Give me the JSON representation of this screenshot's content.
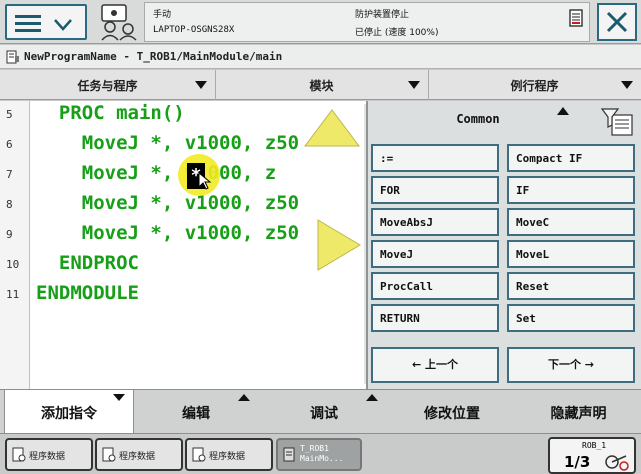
{
  "status": {
    "mode": "手动",
    "system": "LAPTOP-OSGNS28X",
    "safety": "防护装置停止",
    "state": "已停止 (速度 100%)"
  },
  "path": "NewProgramName - T_ROB1/MainModule/main",
  "sections": {
    "tasks": "任务与程序",
    "modules": "模块",
    "routines": "例行程序"
  },
  "code_lines": [
    {
      "num": "5",
      "text": "  PROC main()"
    },
    {
      "num": "6",
      "text": "    MoveJ *, v1000, z50"
    },
    {
      "num": "7",
      "text": "    MoveJ *, v1000, z"
    },
    {
      "num": "8",
      "text": "    MoveJ *, v1000, z50"
    },
    {
      "num": "9",
      "text": "    MoveJ *, v1000, z50"
    },
    {
      "num": "10",
      "text": "  ENDPROC"
    },
    {
      "num": "11",
      "text": "ENDMODULE"
    }
  ],
  "panel": {
    "title": "Common",
    "items": [
      ":=",
      "Compact IF",
      "FOR",
      "IF",
      "MoveAbsJ",
      "MoveC",
      "MoveJ",
      "MoveL",
      "ProcCall",
      "Reset",
      "RETURN",
      "Set"
    ],
    "prev": "← 上一个",
    "next": "下一个 →"
  },
  "tabs": [
    "添加指令",
    "编辑",
    "调试",
    "修改位置",
    "隐藏声明"
  ],
  "taskbar": [
    "程序数据",
    "程序数据",
    "程序数据",
    "T_ROB1 MainMo..."
  ],
  "rob": {
    "name": "ROB_1",
    "fraction": "1/3"
  }
}
